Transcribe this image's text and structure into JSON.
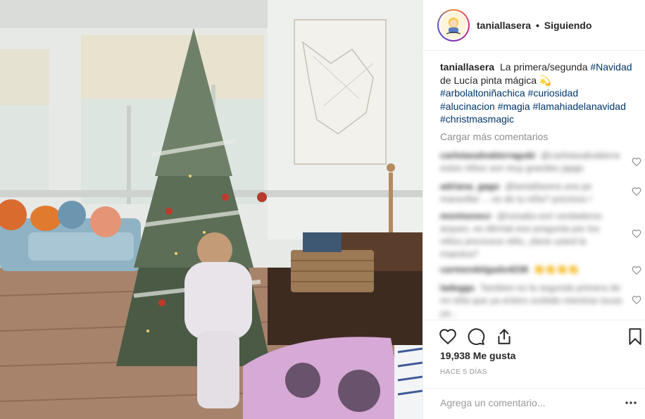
{
  "header": {
    "username": "taniallasera",
    "separator": "•",
    "follow_status": "Siguiendo"
  },
  "caption": {
    "username": "taniallasera",
    "text": "La primera/segunda",
    "tag_1": "#Navidad",
    "text_2": "de Lucía pinta mágica",
    "emoji": "💫",
    "tag_2": "#arbolaltoniñachica",
    "tag_3": "#curiosidad",
    "tag_4": "#alucinacion",
    "tag_5": "#magia",
    "tag_6": "#lamahiadelanavidad",
    "tag_7": "#christmasmagic"
  },
  "load_more_comments": "Cargar más comentarios",
  "comments": [
    {
      "user": "carlotasalvatierragubi",
      "text": "@carlotasalvatierra estos niños son muy grandes jajaja"
    },
    {
      "user": "adriana_gago",
      "text": "@taniallasera una pe maravilla! ... es de tu niña? precioso !"
    },
    {
      "user": "montsesecr",
      "text": "@nosabo.esri verdaderos arqueo, es dérnial eso pregunta por los niños preciosos niño, ¡tiene usted la maestra?"
    },
    {
      "user": "carmendelgado4238",
      "text": "👏👏👏👏"
    },
    {
      "user": "ladeggs",
      "text": "Tambien es la segunda primera de mi niña que ya entero sorbido mientras lucas ya..."
    }
  ],
  "likes_count": "19,938",
  "likes_label": "Me gusta",
  "time_ago": "HACE 5 DÍAS",
  "comment_placeholder": "Agrega un comentario...",
  "icons": {
    "like": "heart-icon",
    "comment": "speech-bubble-icon",
    "share": "share-icon",
    "save": "bookmark-icon",
    "more": "ellipsis-icon"
  },
  "colors": {
    "hashtag": "#003569",
    "muted": "#8e8e8e",
    "border": "#efefef"
  }
}
